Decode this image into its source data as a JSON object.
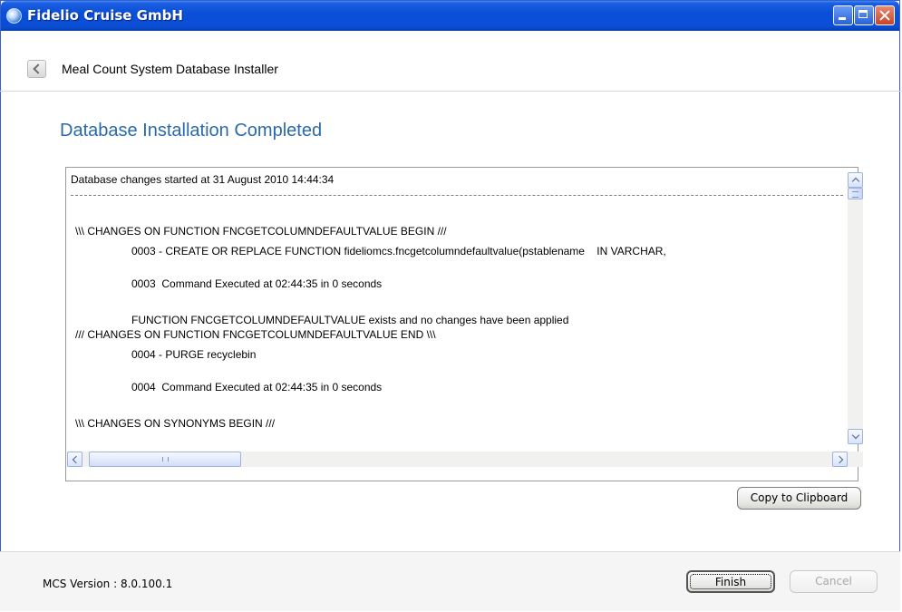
{
  "window": {
    "title": "Fidelio Cruise GmbH",
    "icon": "globe-app-icon",
    "title_bar_color": "#0a4fd8"
  },
  "nav": {
    "title": "Meal Count System Database Installer",
    "back_icon": "chevron-left-icon"
  },
  "page": {
    "heading": "Database Installation Completed",
    "heading_color": "#2a6aac"
  },
  "log": {
    "lines": [
      "Database changes started at 31 August 2010 14:44:34",
      "\\\\\\ CHANGES ON FUNCTION FNCGETCOLUMNDEFAULTVALUE BEGIN ///",
      "0003 - CREATE OR REPLACE FUNCTION fideliomcs.fncgetcolumndefaultvalue(pstablename    IN VARCHAR,",
      "0003  Command Executed at 02:44:35 in 0 seconds",
      "FUNCTION FNCGETCOLUMNDEFAULTVALUE exists and no changes have been applied",
      "/// CHANGES ON FUNCTION FNCGETCOLUMNDEFAULTVALUE END \\\\\\",
      "0004 - PURGE recyclebin",
      "0004  Command Executed at 02:44:35 in 0 seconds",
      "\\\\\\ CHANGES ON SYNONYMS BEGIN ///"
    ],
    "horizontal_scroll_grip": "III"
  },
  "buttons": {
    "copy": "Copy to Clipboard",
    "finish": "Finish",
    "cancel": "Cancel"
  },
  "footer": {
    "version": "MCS Version : 8.0.100.1"
  }
}
